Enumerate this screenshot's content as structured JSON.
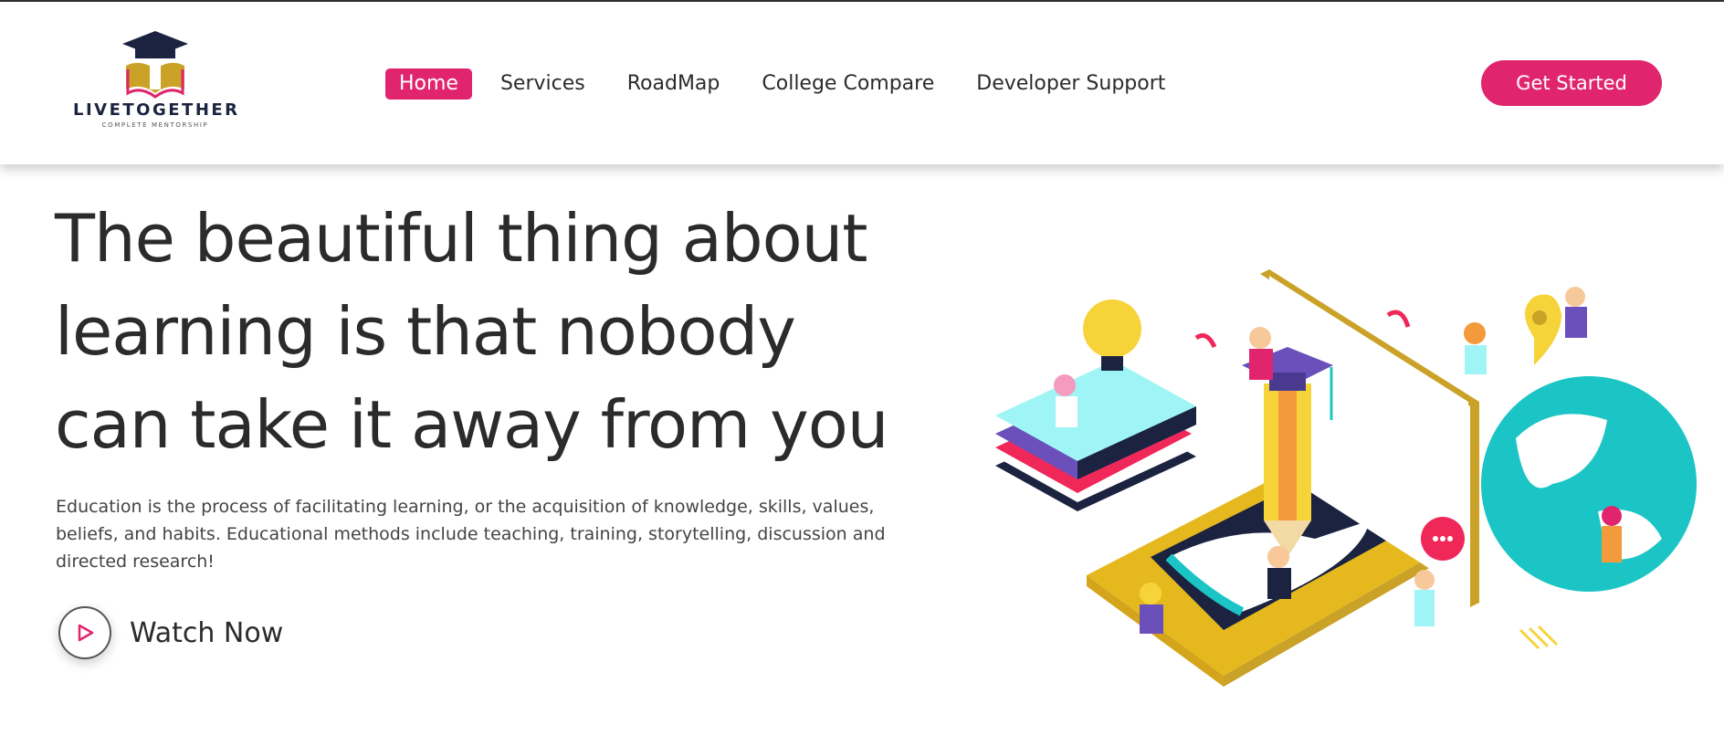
{
  "brand": {
    "name": "LIVETOGETHER",
    "tagline": "COMPLETE MENTORSHIP",
    "logo_icon": "graduation-cap-book-icon"
  },
  "nav": {
    "items": [
      {
        "label": "Home",
        "active": true
      },
      {
        "label": "Services",
        "active": false
      },
      {
        "label": "RoadMap",
        "active": false
      },
      {
        "label": "College Compare",
        "active": false
      },
      {
        "label": "Developer Support",
        "active": false
      }
    ],
    "cta_label": "Get Started"
  },
  "hero": {
    "title_lines": [
      "The beautiful thing about",
      "learning is that nobody",
      "can take it away from you"
    ],
    "description_lines": [
      "Education is the process of facilitating learning, or the acquisition of knowledge, skills, values,",
      "beliefs, and habits. Educational methods include teaching, training, storytelling, discussion and",
      "directed research!"
    ],
    "watch_label": "Watch Now",
    "watch_icon": "play-icon",
    "illustration": "isometric-education-illustration"
  },
  "colors": {
    "accent": "#e0256e",
    "text": "#2b2b2b",
    "navy": "#1b2340",
    "gold": "#c9a227",
    "teal": "#1cc5c5"
  }
}
